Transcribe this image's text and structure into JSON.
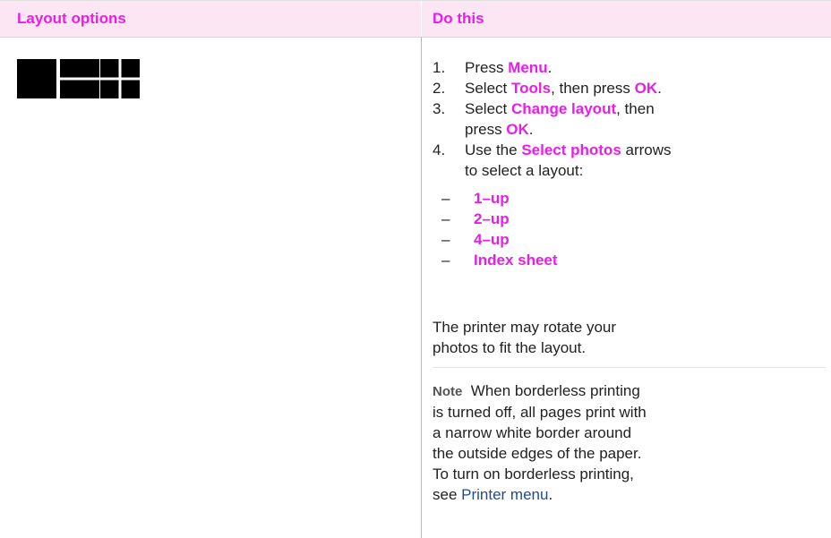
{
  "header": {
    "left": "Layout options",
    "right": "Do this"
  },
  "icons": [
    "layout-1up-icon",
    "layout-2up-icon",
    "layout-4up-icon"
  ],
  "steps": [
    {
      "num": "1.",
      "pre": "Press ",
      "hl1": "Menu",
      "mid": ".",
      "hl2": "",
      "post": ""
    },
    {
      "num": "2.",
      "pre": "Select ",
      "hl1": "Tools",
      "mid": ", then press ",
      "hl2": "OK",
      "post": "."
    },
    {
      "num": "3.",
      "pre": "Select ",
      "hl1": "Change layout",
      "mid": ", then press ",
      "hl2": "OK",
      "post": "."
    },
    {
      "num": "4.",
      "pre": "Use the ",
      "hl1": "Select photos",
      "mid": " arrows to select a layout:",
      "hl2": "",
      "post": ""
    }
  ],
  "layouts": [
    "1–up",
    "2–up",
    "4–up",
    "Index sheet"
  ],
  "dash": "–",
  "rotate_text": "The printer may rotate your photos to fit the layout.",
  "note": {
    "label": "Note",
    "text": "When borderless printing is turned off, all pages print with a narrow white border around the outside edges of the paper. To turn on borderless printing, see ",
    "link": "Printer menu",
    "end": "."
  },
  "colors": {
    "accent": "#e81ee8",
    "header_bg": "#fde6f4",
    "link": "#1f4b94"
  }
}
